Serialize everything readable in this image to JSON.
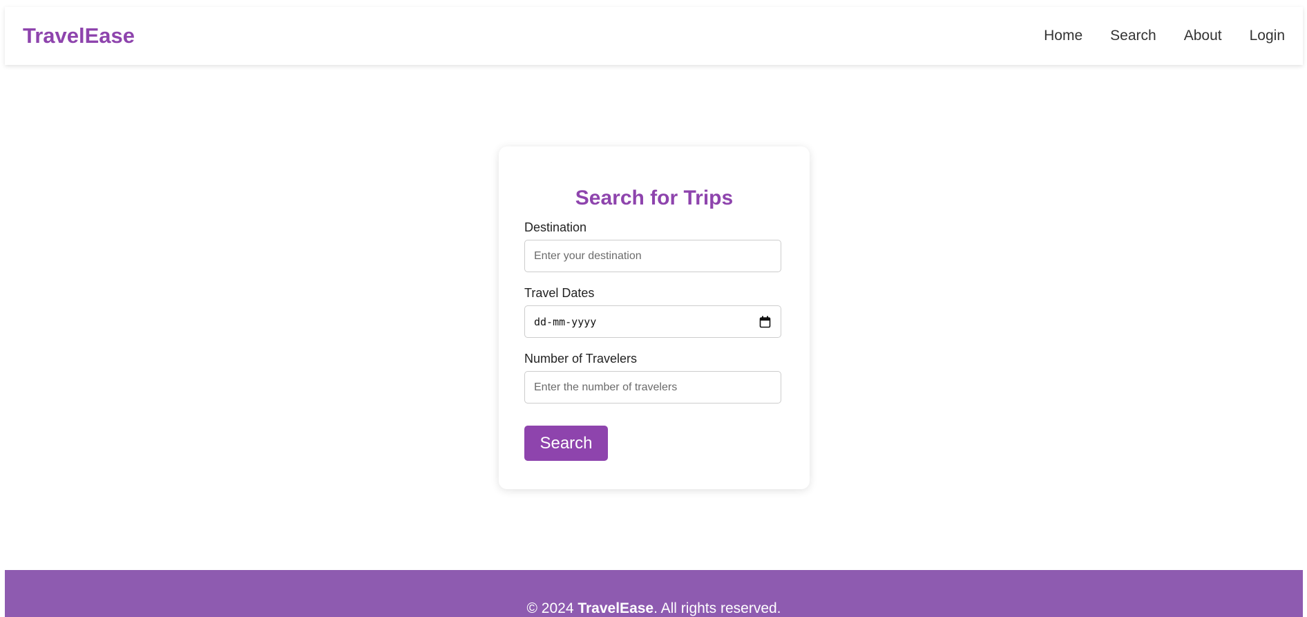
{
  "header": {
    "logo": "TravelEase",
    "nav": [
      "Home",
      "Search",
      "About",
      "Login"
    ]
  },
  "search_form": {
    "title": "Search for Trips",
    "destination": {
      "label": "Destination",
      "placeholder": "Enter your destination",
      "value": ""
    },
    "dates": {
      "label": "Travel Dates",
      "placeholder": "dd-mm-yyyy",
      "value": ""
    },
    "travelers": {
      "label": "Number of Travelers",
      "placeholder": "Enter the number of travelers",
      "value": ""
    },
    "submit_label": "Search"
  },
  "footer": {
    "copyright": "© 2024",
    "brand": "TravelEase",
    "rights": ". All rights reserved."
  },
  "colors": {
    "accent": "#8e44ad",
    "footer_bg": "#8e5bb0"
  },
  "icons": {
    "date_picker": "calendar-icon"
  }
}
